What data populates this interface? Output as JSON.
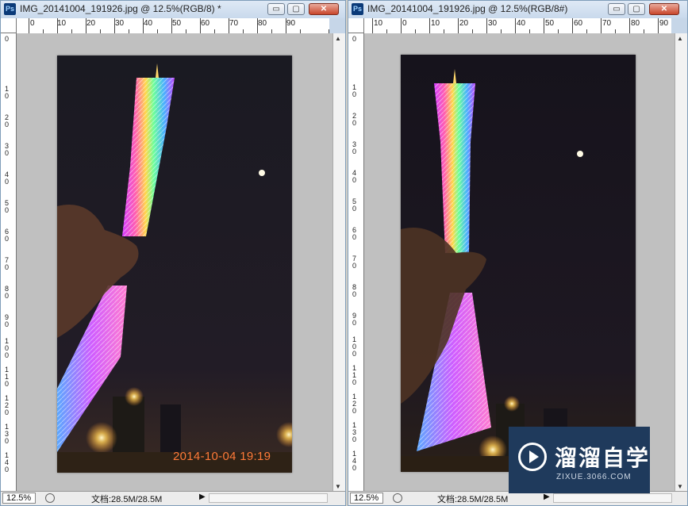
{
  "windows": [
    {
      "title": "IMG_20141004_191926.jpg @ 12.5%(RGB/8) *",
      "zoom": "12.5%",
      "doc_info": "文档:28.5M/28.5M",
      "date_stamp": "2014-10-04 19:19"
    },
    {
      "title": "IMG_20141004_191926.jpg @ 12.5%(RGB/8#)",
      "zoom": "12.5%",
      "doc_info": "文档:28.5M/28.5M"
    }
  ],
  "ruler": {
    "left_top": [
      "0",
      "10",
      "20",
      "30",
      "40",
      "50",
      "60",
      "70",
      "80",
      "90"
    ],
    "right_top": [
      "10",
      "0",
      "10",
      "20",
      "30",
      "40",
      "50",
      "60",
      "70",
      "80",
      "90"
    ],
    "left_side": [
      "0",
      "1\n0",
      "2\n0",
      "3\n0",
      "4\n0",
      "5\n0",
      "6\n0",
      "7\n0",
      "8\n0",
      "9\n0",
      "1\n0\n0",
      "1\n1\n0",
      "1\n2\n0",
      "1\n3\n0",
      "1\n4\n0"
    ]
  },
  "watermark": {
    "text": "溜溜自学",
    "url": "ZIXUE.3066.COM"
  },
  "icons": {
    "app": "photoshop-icon",
    "minimize": "minimize-icon",
    "restore": "restore-icon",
    "close": "close-icon"
  },
  "window_button_labels": {
    "minimize": "▭",
    "restore": "▢",
    "close": "✕"
  },
  "ps_icon_label": "Ps",
  "colors": {
    "date_stamp": "#ff7a3a",
    "watermark_bg": "#1f3a5c"
  }
}
